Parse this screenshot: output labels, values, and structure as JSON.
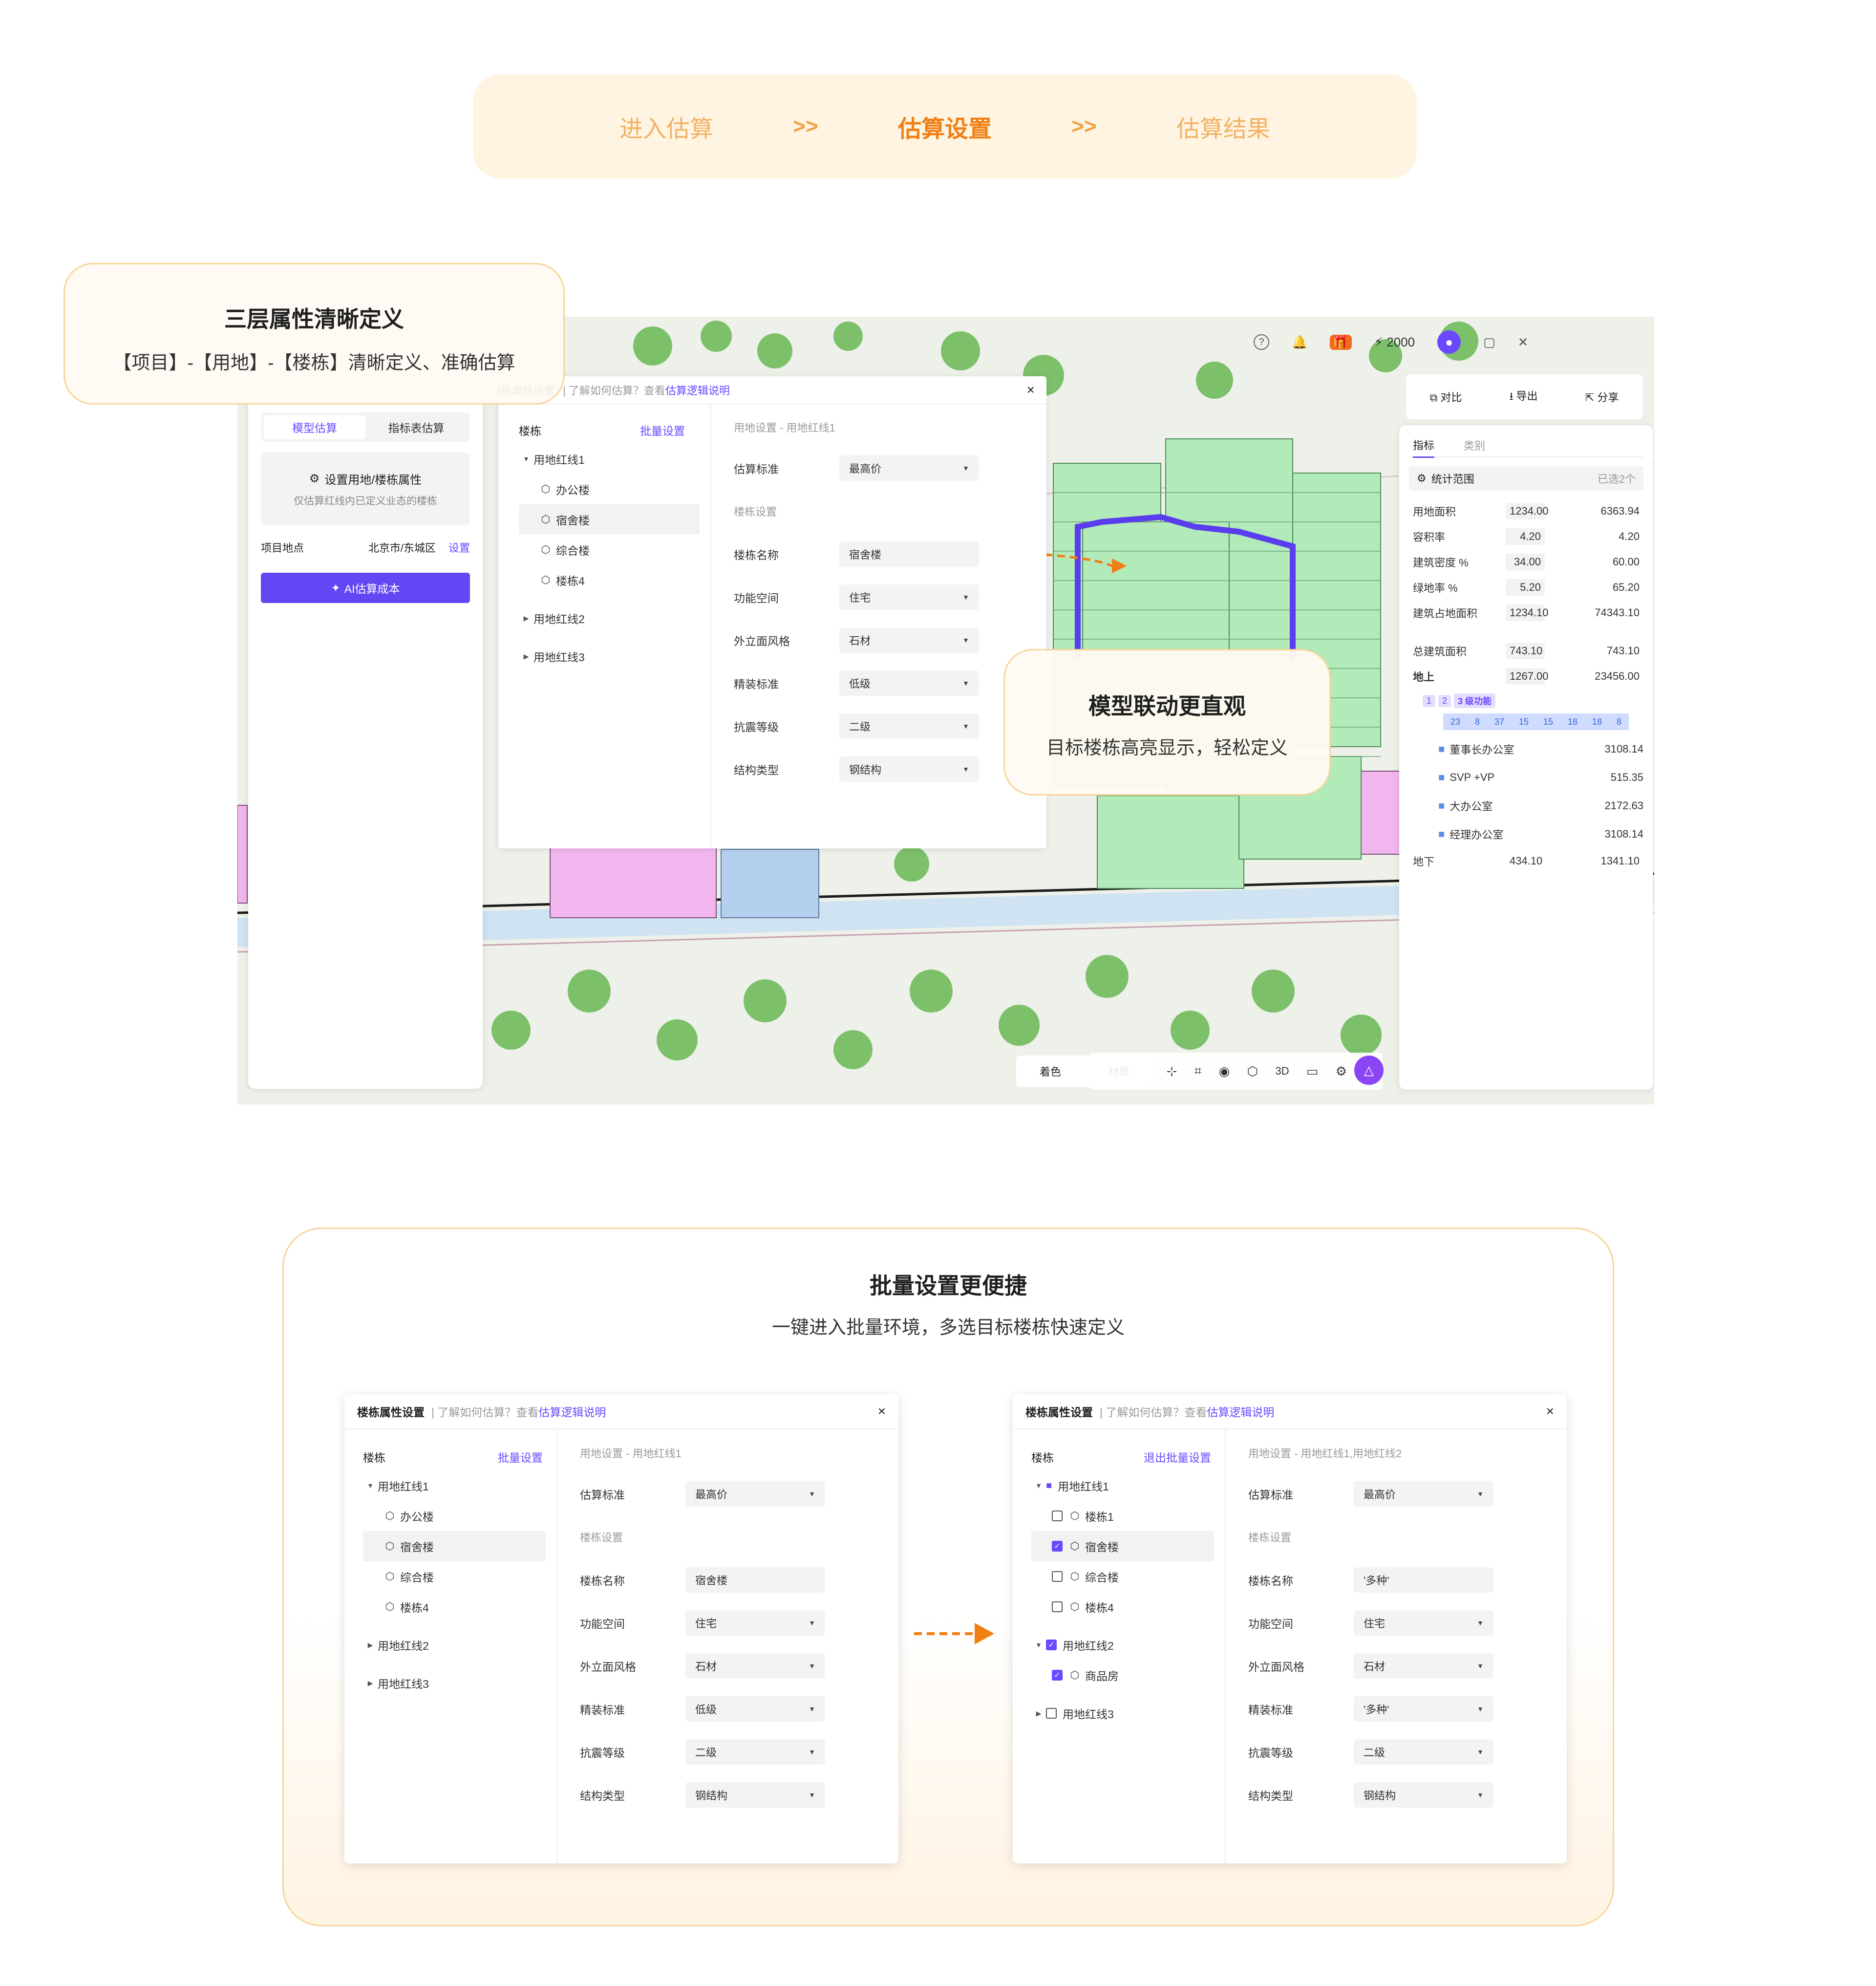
{
  "steps": {
    "s1": "进入估算",
    "a1": ">>",
    "s2": "估算设置",
    "a2": ">>",
    "s3": "估算结果"
  },
  "callout1": {
    "title": "三层属性清晰定义",
    "desc": "【项目】-【用地】-【楼栋】清晰定义、准确估算"
  },
  "callout2": {
    "title": "模型联动更直观",
    "desc": "目标楼栋高亮显示，轻松定义"
  },
  "left_panel": {
    "tab1": "模型估算",
    "tab2": "指标表估算",
    "set_title": "设置用地/楼栋属性",
    "set_desc": "仅估算红线内已定义业态的楼栋",
    "loc_label": "项目地点",
    "loc_value": "北京市/东城区",
    "loc_action": "设置",
    "ai_button": "AI估算成本"
  },
  "top_bar": {
    "credits": "2000",
    "help": "?"
  },
  "dialog": {
    "title": "楼栋属性设置",
    "hint_prefix": "| 了解如何估算？查看",
    "hint_link": "估算逻辑说明",
    "close": "×",
    "tree_header": "楼栋",
    "batch": "批量设置",
    "exit_batch": "退出批量设置",
    "site1": "用地红线1",
    "site2": "用地红线2",
    "site3": "用地红线3",
    "b1": "办公楼",
    "b2": "宿舍楼",
    "b3": "综合楼",
    "b4": "楼栋4",
    "b5": "楼栋1",
    "b6": "商品房",
    "crumb": "用地设置 - 用地红线1",
    "crumb2": "用地设置 - 用地红线1,用地红线2",
    "f_std": "估算标准",
    "v_std": "最高价",
    "section": "楼栋设置",
    "f_name": "楼栋名称",
    "v_name": "宿舍楼",
    "v_multi": "'多种'",
    "f_func": "功能空间",
    "v_func": "住宅",
    "f_facade": "外立面风格",
    "v_facade": "石材",
    "f_fit": "精装标准",
    "v_fit": "低级",
    "f_seis": "抗震等级",
    "v_seis": "二级",
    "f_struct": "结构类型",
    "v_struct": "钢结构"
  },
  "right_panel": {
    "compare": "对比",
    "export": "导出",
    "share": "分享",
    "tab1": "指标",
    "tab2": "类别",
    "scope": "统计范围",
    "scope_val": "已选2个",
    "rows": [
      {
        "k": "用地面积",
        "a": "1234.00",
        "b": "6363.94"
      },
      {
        "k": "容积率",
        "a": "4.20",
        "b": "4.20"
      },
      {
        "k": "建筑密度 %",
        "a": "34.00",
        "b": "60.00"
      },
      {
        "k": "绿地率 %",
        "a": "5.20",
        "b": "65.20"
      },
      {
        "k": "建筑占地面积",
        "a": "1234.10",
        "b": "74343.10"
      },
      {
        "k": "总建筑面积",
        "a": "743.10",
        "b": "743.10"
      },
      {
        "k": "地上",
        "a": "1267.00",
        "b": "23456.00"
      }
    ],
    "lv1": "1",
    "lv2": "2",
    "lv3": "3 级功能",
    "bars": [
      "23",
      "8",
      "37",
      "15",
      "15",
      "18",
      "18",
      "8"
    ],
    "items": [
      {
        "k": "董事长办公室",
        "v": "3108.14"
      },
      {
        "k": "SVP +VP",
        "v": "515.35"
      },
      {
        "k": "大办公室",
        "v": "2172.63"
      },
      {
        "k": "经理办公室",
        "v": "3108.14"
      }
    ],
    "under": {
      "k": "地下",
      "a": "434.10",
      "b": "1341.10"
    }
  },
  "toolbar": {
    "color": "着色",
    "material": "材质",
    "threeD": "3D"
  },
  "section2": {
    "title": "批量设置更便捷",
    "desc": "一键进入批量环境，多选目标楼栋快速定义"
  },
  "colors": {
    "accent": "#6b48ff",
    "orange": "#f07f14",
    "green": "#a9e6b3",
    "pink": "#f0b4ec",
    "blue": "#a9c8ec"
  }
}
